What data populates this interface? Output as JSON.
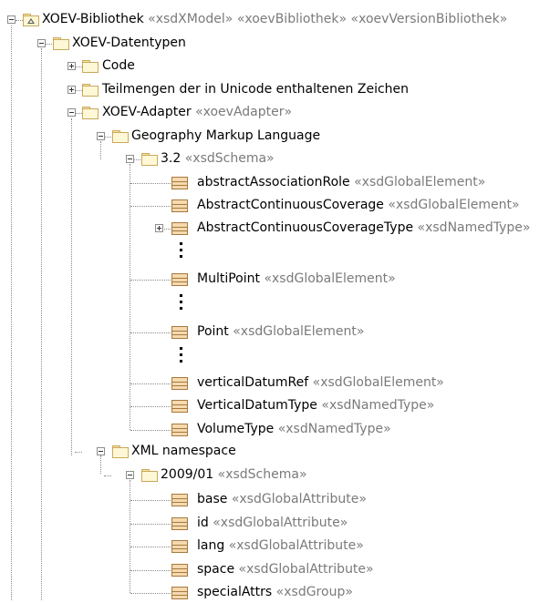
{
  "tree": {
    "root": {
      "name": "XOEV-Bibliothek",
      "stereotype": "«xsdXModel» «xoevBibliothek» «xoevVersionBibliothek»"
    },
    "datentypen": {
      "name": "XOEV-Datentypen"
    },
    "code": {
      "name": "Code"
    },
    "teilmengen": {
      "name": "Teilmengen der in Unicode enthaltenen Zeichen"
    },
    "adapter": {
      "name": "XOEV-Adapter",
      "stereotype": "«xoevAdapter»"
    },
    "gml": {
      "name": "Geography Markup Language"
    },
    "schema32": {
      "name": "3.2",
      "stereotype": "«xsdSchema»"
    },
    "gml_items": [
      {
        "name": "abstractAssociationRole",
        "stereotype": "«xsdGlobalElement»"
      },
      {
        "name": "AbstractContinuousCoverage",
        "stereotype": "«xsdGlobalElement»"
      },
      {
        "name": "AbstractContinuousCoverageType",
        "stereotype": "«xsdNamedType»"
      },
      {
        "name": "MultiPoint",
        "stereotype": "«xsdGlobalElement»"
      },
      {
        "name": "Point",
        "stereotype": "«xsdGlobalElement»"
      },
      {
        "name": "verticalDatumRef",
        "stereotype": "«xsdGlobalElement»"
      },
      {
        "name": "VerticalDatumType",
        "stereotype": "«xsdNamedType»"
      },
      {
        "name": "VolumeType",
        "stereotype": "«xsdNamedType»"
      }
    ],
    "xmlns": {
      "name": "XML namespace"
    },
    "schema2009": {
      "name": "2009/01",
      "stereotype": "«xsdSchema»"
    },
    "xml_items": [
      {
        "name": "base",
        "stereotype": "«xsdGlobalAttribute»"
      },
      {
        "name": "id",
        "stereotype": "«xsdGlobalAttribute»"
      },
      {
        "name": "lang",
        "stereotype": "«xsdGlobalAttribute»"
      },
      {
        "name": "space",
        "stereotype": "«xsdGlobalAttribute»"
      },
      {
        "name": "specialAttrs",
        "stereotype": "«xsdGroup»"
      }
    ]
  },
  "icons": {
    "package": "package-folder-icon",
    "model": "model-package-icon",
    "element": "xsd-element-icon",
    "expander_open": "collapse-minus-icon",
    "expander_closed": "expand-plus-icon"
  }
}
